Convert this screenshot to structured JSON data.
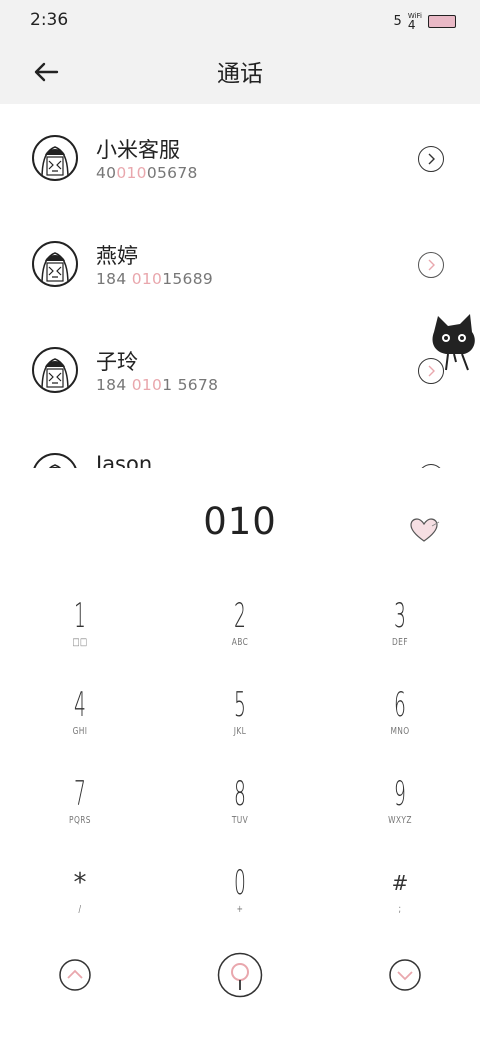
{
  "status_bar": {
    "time": "2:36",
    "signal": "5",
    "wifi_label": "WiFi",
    "wifi_bars": "4"
  },
  "header": {
    "title": "通话"
  },
  "contacts": [
    {
      "name": "小米客服",
      "number_parts": [
        "40",
        "010",
        "05678"
      ]
    },
    {
      "name": "燕婷",
      "number_parts": [
        "184 ",
        "010",
        "15689"
      ]
    },
    {
      "name": "子玲",
      "number_parts": [
        "184 ",
        "010",
        "1 5678"
      ]
    },
    {
      "name": "Jason",
      "number_parts": [
        "",
        "",
        ""
      ]
    }
  ],
  "dialer": {
    "input": "010",
    "keys": [
      {
        "digit": "1",
        "sub": "□□"
      },
      {
        "digit": "2",
        "sub": "ABC"
      },
      {
        "digit": "3",
        "sub": "DEF"
      },
      {
        "digit": "4",
        "sub": "GHI"
      },
      {
        "digit": "5",
        "sub": "JKL"
      },
      {
        "digit": "6",
        "sub": "MNO"
      },
      {
        "digit": "7",
        "sub": "PQRS"
      },
      {
        "digit": "8",
        "sub": "TUV"
      },
      {
        "digit": "9",
        "sub": "WXYZ"
      },
      {
        "digit": "*",
        "sub": "/"
      },
      {
        "digit": "0",
        "sub": "+"
      },
      {
        "digit": "#",
        "sub": ";"
      }
    ]
  },
  "colors": {
    "accent": "#e9a7ad",
    "header_bg": "#f2f2f2",
    "battery": "#e9b9c6"
  },
  "icons": {
    "back": "arrow-left-icon",
    "contact_detail": "chevron-right-circle-icon",
    "favorite": "heart-icon",
    "collapse": "chevron-up-circle-icon",
    "call": "search-circle-icon",
    "expand": "chevron-down-circle-icon"
  }
}
